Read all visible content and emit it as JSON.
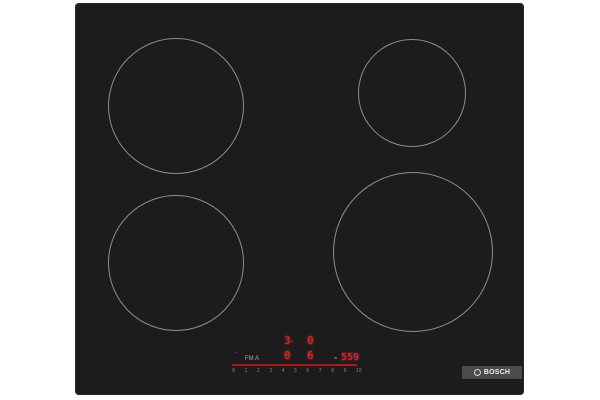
{
  "brand": {
    "name": "BOSCH"
  },
  "top_labels": {
    "left": "",
    "right_line1": "",
    "right_line2": "",
    "right_line3": ""
  },
  "zones": [
    {
      "label": ""
    },
    {
      "label": ""
    },
    {
      "label": ""
    },
    {
      "label": ""
    }
  ],
  "display": {
    "upper_left_digit": "3",
    "upper_left_suffix": "o",
    "upper_right_digit": "0",
    "lower_left_digit": "0",
    "lower_right_digit": "6",
    "timer": "559",
    "left_icons": "FM A",
    "small_prefix": "≈"
  },
  "scale": {
    "labels": [
      "0",
      "1",
      "2",
      "3",
      "4",
      "5",
      "6",
      "7",
      "8",
      "9",
      "10"
    ]
  },
  "colors": {
    "body": "#1c1c1c",
    "accent": "#e0202a",
    "brand_bg": "#4b4b4b"
  }
}
